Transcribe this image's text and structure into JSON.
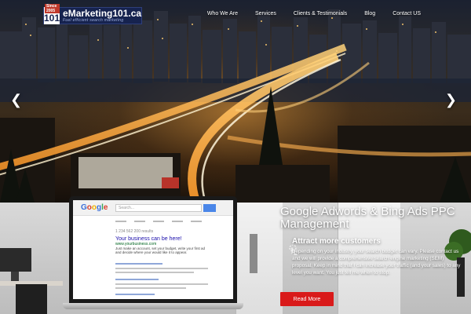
{
  "brand": {
    "badge": "Since 2005",
    "mark": "101",
    "name": "eMarketing101.ca",
    "tagline": "Fuel efficient search marketing"
  },
  "nav": {
    "items": [
      {
        "label": "Who We Are"
      },
      {
        "label": "Services"
      },
      {
        "label": "Clients & Testimonials"
      },
      {
        "label": "Blog"
      },
      {
        "label": "Contact US"
      }
    ]
  },
  "slider": {
    "prev_icon": "chevron-left-icon",
    "next_icon": "chevron-right-icon"
  },
  "laptop": {
    "search_placeholder": "Search...",
    "results_count": "1 234 562 200 results",
    "ad_title": "Your business can be here!",
    "ad_url": "www.yourbusiness.com",
    "ad_desc": "Just make an account, set your budget, write your first ad and decide where your would like it to appear."
  },
  "promo": {
    "headline": "Google Adwords & Bing Ads PPC Management",
    "subhead": "Attract more customers",
    "body": "Depending on your industry, your search budget can vary. Please contact us and we will provide a comprehensive search engine marketing (SEM) proposal. Keep in mind that I can increase your traffic (and your sales) to any level you want. You just tell me when to stop.",
    "cta": "Read More"
  },
  "colors": {
    "cta": "#d91a1a",
    "logo_bg": "#16234f"
  }
}
